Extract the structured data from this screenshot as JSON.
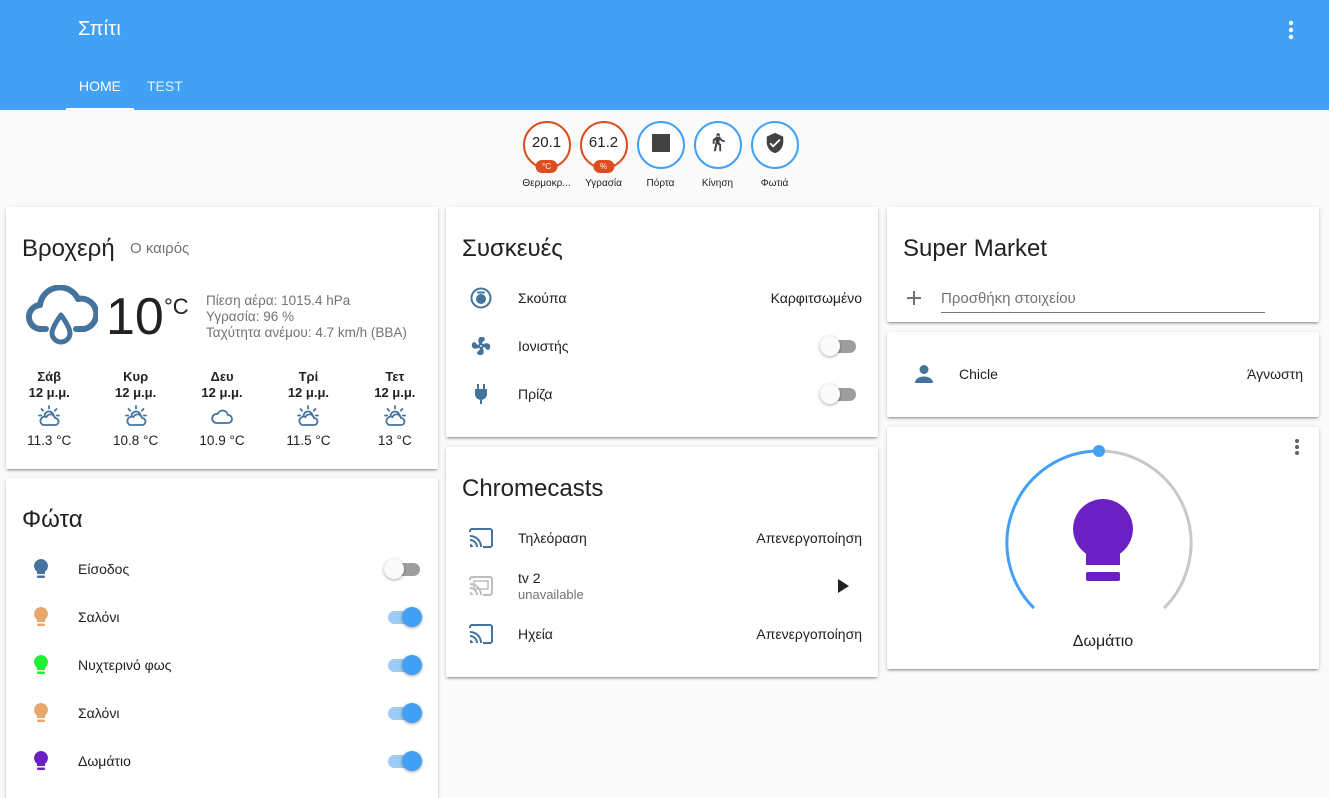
{
  "header": {
    "title": "Σπίτι",
    "tabs": [
      {
        "label": "HOME"
      },
      {
        "label": "TEST"
      }
    ]
  },
  "badges": [
    {
      "value": "20.1",
      "unit": "°C",
      "label": "Θερμοκρ...",
      "color": "#df4c1e"
    },
    {
      "value": "61.2",
      "unit": "%",
      "label": "Υγρασία",
      "color": "#df4c1e"
    },
    {
      "icon": "square-stop-icon",
      "label": "Πόρτα"
    },
    {
      "icon": "walk-icon",
      "label": "Κίνηση"
    },
    {
      "icon": "shield-check-icon",
      "label": "Φωτιά"
    }
  ],
  "weather": {
    "title": "Βροχερή",
    "subtitle": "Ο καιρός",
    "temperature": "10",
    "unit": "°C",
    "attributes": [
      "Πίεση αέρα: 1015.4 hPa",
      "Υγρασία: 96 %",
      "Ταχύτητα ανέμου: 4.7 km/h (ΒΒΑ)"
    ],
    "forecast": [
      {
        "day": "Σάβ",
        "time": "12 μ.μ.",
        "icon": "partly-cloudy-icon",
        "temp": "11.3 °C"
      },
      {
        "day": "Κυρ",
        "time": "12 μ.μ.",
        "icon": "partly-cloudy-icon",
        "temp": "10.8 °C"
      },
      {
        "day": "Δευ",
        "time": "12 μ.μ.",
        "icon": "cloudy-icon",
        "temp": "10.9 °C"
      },
      {
        "day": "Τρί",
        "time": "12 μ.μ.",
        "icon": "partly-cloudy-icon",
        "temp": "11.5 °C"
      },
      {
        "day": "Τετ",
        "time": "12 μ.μ.",
        "icon": "partly-cloudy-icon",
        "temp": "13 °C"
      }
    ]
  },
  "lights": {
    "title": "Φώτα",
    "items": [
      {
        "name": "Είσοδος",
        "on": false,
        "color": "#44739e"
      },
      {
        "name": "Σαλόνι",
        "on": true,
        "color": "#e8a86c"
      },
      {
        "name": "Νυχτερινό φως",
        "on": true,
        "color": "#22ee33"
      },
      {
        "name": "Σαλόνι",
        "on": true,
        "color": "#e8a86c"
      },
      {
        "name": "Δωμάτιο",
        "on": true,
        "color": "#6a20c2"
      }
    ]
  },
  "devices": {
    "title": "Συσκευές",
    "items": [
      {
        "name": "Σκούπα",
        "state": "Καρφιτσωμένο",
        "icon": "robot-vacuum-icon"
      },
      {
        "name": "Ιονιστής",
        "on": false,
        "icon": "fan-icon"
      },
      {
        "name": "Πρίζα",
        "on": false,
        "icon": "power-plug-icon"
      }
    ]
  },
  "chromecasts": {
    "title": "Chromecasts",
    "items": [
      {
        "name": "Τηλεόραση",
        "state": "Απενεργοποίηση"
      },
      {
        "name": "tv 2",
        "sub": "unavailable"
      },
      {
        "name": "Ηχεία",
        "state": "Απενεργοποίηση"
      }
    ]
  },
  "shopping": {
    "title": "Super Market",
    "placeholder": "Προσθήκη στοιχείου"
  },
  "person": {
    "name": "Chicle",
    "state": "Άγνωστη"
  },
  "light_card": {
    "name": "Δωμάτιο",
    "brightness_fraction": 0.5,
    "color": "#6a20c2"
  },
  "colors": {
    "primary": "#42a0f5",
    "icon": "#44739e",
    "badge_red": "#df4c1e"
  }
}
